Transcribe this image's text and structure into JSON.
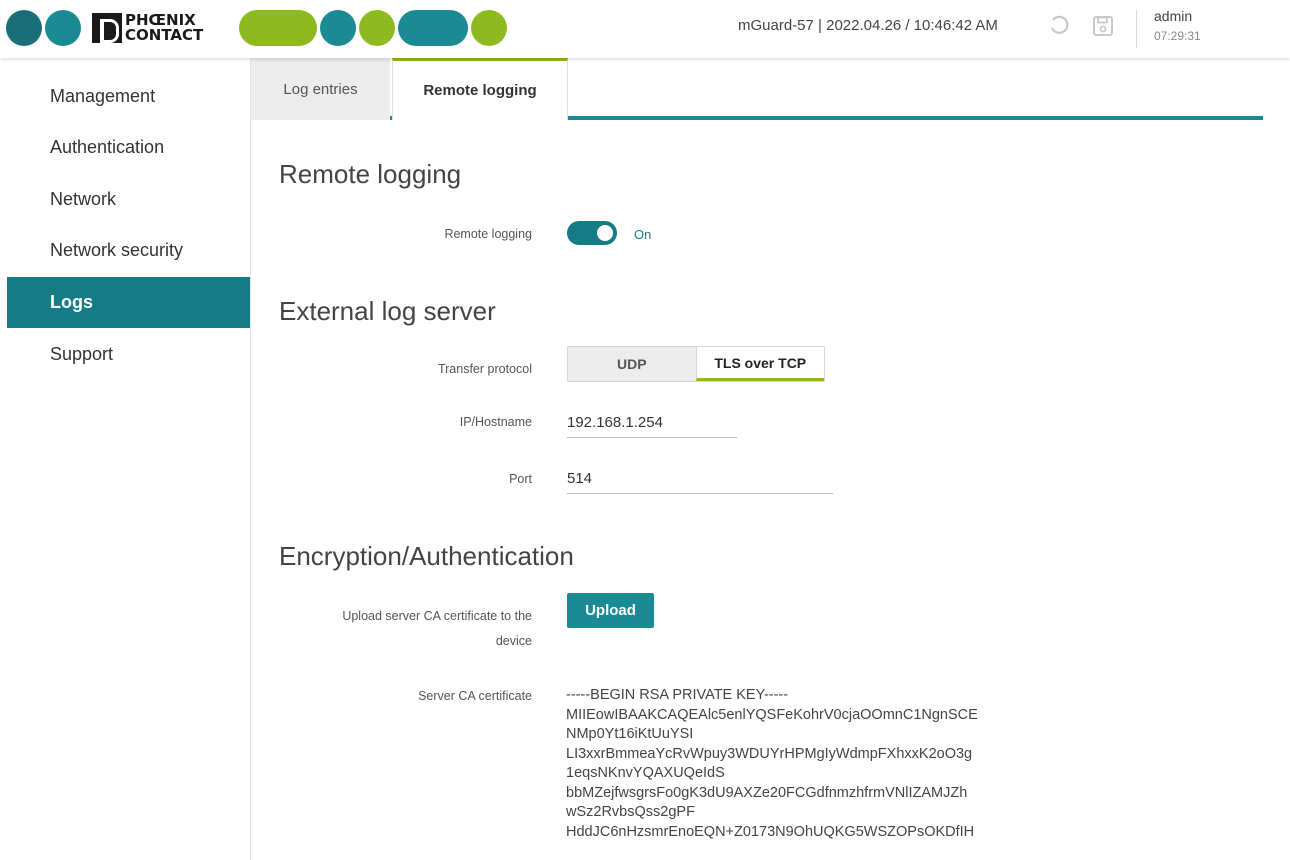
{
  "header": {
    "brand_line1": "PHŒNIX",
    "brand_line2": "CONTACT",
    "device_status": "mGuard-57 | 2022.04.26 / 10:46:42 AM",
    "user": "admin",
    "session_time": "07:29:31",
    "icons": [
      "undo-icon",
      "save-icon"
    ]
  },
  "colors": {
    "teal": "#157b85",
    "green": "#8dbb1f",
    "logo_dark": "#1a6e78",
    "logo_teal": "#1a8b94"
  },
  "sidebar": {
    "items": [
      {
        "label": "Management"
      },
      {
        "label": "Authentication"
      },
      {
        "label": "Network"
      },
      {
        "label": "Network security"
      },
      {
        "label": "Logs",
        "active": true
      },
      {
        "label": "Support"
      }
    ]
  },
  "tabs": [
    {
      "label": "Log entries"
    },
    {
      "label": "Remote logging",
      "active": true
    }
  ],
  "remote_logging": {
    "title": "Remote logging",
    "toggle_label": "Remote logging",
    "toggle_state": "On"
  },
  "external_log_server": {
    "title": "External log server",
    "protocol_label": "Transfer protocol",
    "protocol_options": [
      "UDP",
      "TLS over TCP"
    ],
    "protocol_selected": "TLS over TCP",
    "host_label": "IP/Hostname",
    "host_value": "192.168.1.254",
    "port_label": "Port",
    "port_value": "514"
  },
  "encryption": {
    "title": "Encryption/Authentication",
    "upload_label_line1": "Upload server CA certificate to the",
    "upload_label_line2": "device",
    "upload_button": "Upload",
    "cert_label": "Server CA certificate",
    "cert_text": "-----BEGIN RSA PRIVATE KEY-----\nMIIEowIBAAKCAQEAlc5enlYQSFeKohrV0cjaOOmnC1NgnSCE\nNMp0Yt16iKtUuYSI\nLI3xxrBmmeaYcRvWpuy3WDUYrHPMgIyWdmpFXhxxK2oO3g\n1eqsNKnvYQAXUQeIdS\nbbMZejfwsgrsFo0gK3dU9AXZe20FCGdfnmzhfrmVNlIZAMJZh\nwSz2RvbsQss2gPF\nHddJC6nHzsmrEnoEQN+Z0173N9OhUQKG5WSZOPsOKDfIH"
  }
}
